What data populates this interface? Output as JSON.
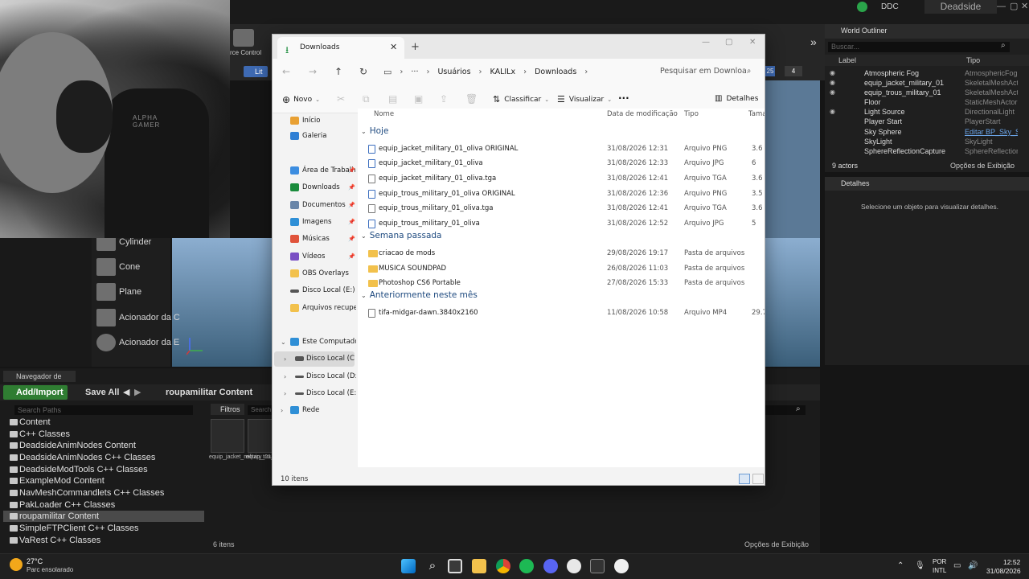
{
  "unreal": {
    "project_name": "Deadside",
    "ddc_label": "DDC",
    "toolbar_label": "rce Control",
    "lit_button": "Lit",
    "viewport_num1": "25",
    "viewport_num2": "4",
    "place_items": [
      "Cylinder",
      "Cone",
      "Plane",
      "Acionador da C",
      "Acionador da E"
    ],
    "world_outliner": {
      "title": "World Outliner",
      "search_placeholder": "Buscar...",
      "col_label": "Label",
      "col_type": "Tipo",
      "rows": [
        {
          "label": "Atmospheric Fog",
          "type": "AtmosphericFog"
        },
        {
          "label": "equip_jacket_military_01",
          "type": "SkeletalMeshActo"
        },
        {
          "label": "equip_trous_military_01",
          "type": "SkeletalMeshActo"
        },
        {
          "label": "Floor",
          "type": "StaticMeshActor"
        },
        {
          "label": "Light Source",
          "type": "DirectionalLight"
        },
        {
          "label": "Player Start",
          "type": "PlayerStart"
        },
        {
          "label": "Sky Sphere",
          "type": "Editar BP_Sky_S"
        },
        {
          "label": "SkyLight",
          "type": "SkyLight"
        },
        {
          "label": "SphereReflectionCapture",
          "type": "SphereReflectionC"
        }
      ],
      "actor_count": "9 actors",
      "view_options": "Opções de Exibição"
    },
    "details": {
      "title": "Detalhes",
      "empty_message": "Selecione um objeto para visualizar detalhes."
    },
    "content_browser": {
      "tab_label": "Navegador de Con",
      "add_import": "Add/Import",
      "save_all": "Save All",
      "current_path": "roupamilitar Content",
      "search_paths_placeholder": "Search Paths",
      "filters": "Filtros",
      "search_placeholder": "Search",
      "tree": [
        "Content",
        "C++ Classes",
        "DeadsideAnimNodes Content",
        "DeadsideAnimNodes C++ Classes",
        "DeadsideModTools C++ Classes",
        "ExampleMod Content",
        "NavMeshCommandlets C++ Classes",
        "PakLoader C++ Classes",
        "roupamilitar Content",
        "SimpleFTPClient C++ Classes",
        "VaRest C++ Classes"
      ],
      "assets": [
        "equip_jacket_military_01_oliva",
        "equip_trous_military_01_oliva"
      ],
      "item_count": "6 itens",
      "view_options": "Opções de Exibição"
    }
  },
  "explorer": {
    "tab_title": "Downloads",
    "breadcrumb": [
      "Usuários",
      "KALILx",
      "Downloads"
    ],
    "search_placeholder": "Pesquisar em Downloa",
    "commands": {
      "new": "Novo",
      "sort": "Classificar",
      "view": "Visualizar",
      "more": "...",
      "details": "Detalhes"
    },
    "nav_pane": [
      {
        "label": "Início",
        "color": "#e8a033"
      },
      {
        "label": "Galeria",
        "color": "#2f7fd4"
      },
      {
        "label": "Área de Trabalho",
        "color": "#3c8de0",
        "pinned": true
      },
      {
        "label": "Downloads",
        "color": "#1a8c3c",
        "pinned": true
      },
      {
        "label": "Documentos",
        "color": "#6a86a8",
        "pinned": true
      },
      {
        "label": "Imagens",
        "color": "#2f8fd6",
        "pinned": true
      },
      {
        "label": "Músicas",
        "color": "#e0533b",
        "pinned": true
      },
      {
        "label": "Vídeos",
        "color": "#7a4fc4",
        "pinned": true
      },
      {
        "label": "OBS Overlays",
        "color": "#f2c14c"
      },
      {
        "label": "Disco Local (E:)",
        "color": "#555555"
      },
      {
        "label": "Arquivos recuperac",
        "color": "#f2c14c"
      }
    ],
    "nav_tree": [
      {
        "label": "Este Computador",
        "expanded": true
      },
      {
        "label": "Disco Local (C:)",
        "selected": true
      },
      {
        "label": "Disco Local (D:)"
      },
      {
        "label": "Disco Local (E:)"
      },
      {
        "label": "Rede"
      }
    ],
    "columns": {
      "name": "Nome",
      "date": "Data de modificação",
      "type": "Tipo",
      "size": "Taman"
    },
    "groups": [
      {
        "title": "Hoje",
        "files": [
          {
            "name": "equip_jacket_military_01_oliva ORIGINAL",
            "date": "31/08/2026 12:31",
            "type": "Arquivo PNG",
            "size": "3.6"
          },
          {
            "name": "equip_jacket_military_01_oliva",
            "date": "31/08/2026 12:33",
            "type": "Arquivo JPG",
            "size": "6"
          },
          {
            "name": "equip_jacket_military_01_oliva.tga",
            "date": "31/08/2026 12:41",
            "type": "Arquivo TGA",
            "size": "3.6"
          },
          {
            "name": "equip_trous_military_01_oliva ORIGINAL",
            "date": "31/08/2026 12:36",
            "type": "Arquivo PNG",
            "size": "3.5"
          },
          {
            "name": "equip_trous_military_01_oliva.tga",
            "date": "31/08/2026 12:41",
            "type": "Arquivo TGA",
            "size": "3.6"
          },
          {
            "name": "equip_trous_military_01_oliva",
            "date": "31/08/2026 12:52",
            "type": "Arquivo JPG",
            "size": "5"
          }
        ]
      },
      {
        "title": "Semana passada",
        "files": [
          {
            "name": "criacao de mods",
            "date": "29/08/2026 19:17",
            "type": "Pasta de arquivos",
            "size": ""
          },
          {
            "name": "MUSICA SOUNDPAD",
            "date": "26/08/2026 11:03",
            "type": "Pasta de arquivos",
            "size": ""
          },
          {
            "name": "Photoshop CS6 Portable",
            "date": "27/08/2026 15:33",
            "type": "Pasta de arquivos",
            "size": ""
          }
        ]
      },
      {
        "title": "Anteriormente neste mês",
        "files": [
          {
            "name": "tifa-midgar-dawn.3840x2160",
            "date": "11/08/2026 10:58",
            "type": "Arquivo MP4",
            "size": "29.7"
          }
        ]
      }
    ],
    "status_count": "10 itens"
  },
  "taskbar": {
    "temperature": "27°C",
    "weather": "Parc ensolarado",
    "lang1": "POR",
    "lang2": "INTL",
    "time": "12:52",
    "date": "31/08/2026"
  }
}
